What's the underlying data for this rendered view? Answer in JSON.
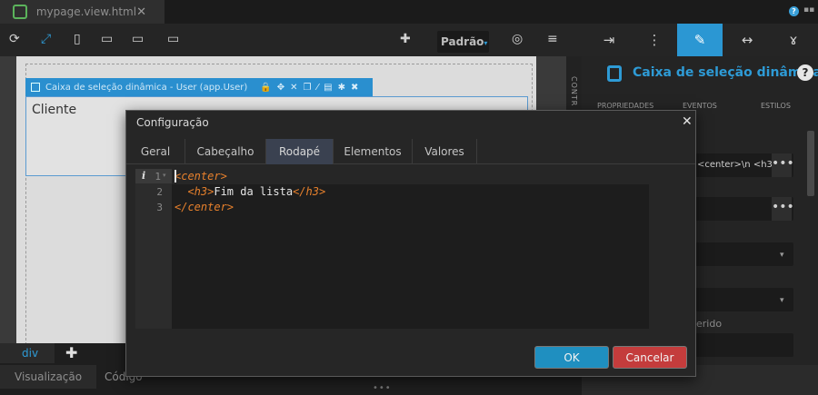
{
  "titlebar": {
    "file_name": "mypage.view.html",
    "close_glyph": "✕",
    "help_glyph": "?",
    "menu_glyph": "▪▪"
  },
  "toolbar": {
    "icons": [
      "refresh-icon",
      "expand-icon",
      "phone-icon",
      "tablet-icon",
      "desktop-icon",
      "monitor-icon",
      "plus-icon",
      "eye-off-icon",
      "database-icon"
    ],
    "glyphs": {
      "refresh": "⟳",
      "expand": "⤢",
      "phone": "▯",
      "tablet": "▭",
      "desktop": "▭",
      "monitor": "▭",
      "plus": "✚",
      "eye": "◎",
      "database": "≡"
    },
    "preset_label": "Padrão",
    "preset_caret": "▾"
  },
  "right_toolbar": {
    "glyphs": {
      "login": "⇥",
      "tree": "⋮",
      "brush": "✎",
      "arrows": "↔",
      "tools": "ɤ"
    },
    "active": "brush"
  },
  "canvas": {
    "component_label": "Caixa de seleção dinâmica - User (app.User)",
    "component_actions": [
      "lock-icon",
      "move-icon",
      "arrows-icon",
      "copy-icon",
      "wand-icon",
      "database-icon",
      "gear-icon",
      "close-icon"
    ],
    "action_glyphs": [
      "🔒",
      "✥",
      "✕",
      "❐",
      "⁄",
      "▤",
      "✱",
      "✖"
    ],
    "field_text": "Cliente"
  },
  "side_strip": {
    "label": "CONTR"
  },
  "properties": {
    "title": "Caixa de seleção dinâmica",
    "help_glyph": "?",
    "tabs": [
      "PROPRIEDADES",
      "EVENTOS",
      "ESTILOS"
    ],
    "field_footer_value": "<center>\\n <h3",
    "dots_glyph": "•••",
    "dropdown_caret": "▾",
    "partial_label": "erido"
  },
  "bottom": {
    "breadcrumb": "div",
    "add_glyph": "✚",
    "tabs": [
      "Visualização",
      "Código"
    ],
    "handle_glyph": "•••"
  },
  "dialog": {
    "title": "Configuração",
    "close_glyph": "✕",
    "tabs": [
      "Geral",
      "Cabeçalho",
      "Rodapé",
      "Elementos",
      "Valores"
    ],
    "active_tab": "Rodapé",
    "gutter_info": "i",
    "gutter_fold": "▾",
    "line_numbers": [
      "1",
      "2",
      "3"
    ],
    "code": {
      "l1_open": "<center>",
      "l2_indent": "  ",
      "l2_open": "<h3>",
      "l2_text": "Fim da lista",
      "l2_close": "</h3>",
      "l3_close": "</center>"
    },
    "ok_label": "OK",
    "cancel_label": "Cancelar"
  }
}
